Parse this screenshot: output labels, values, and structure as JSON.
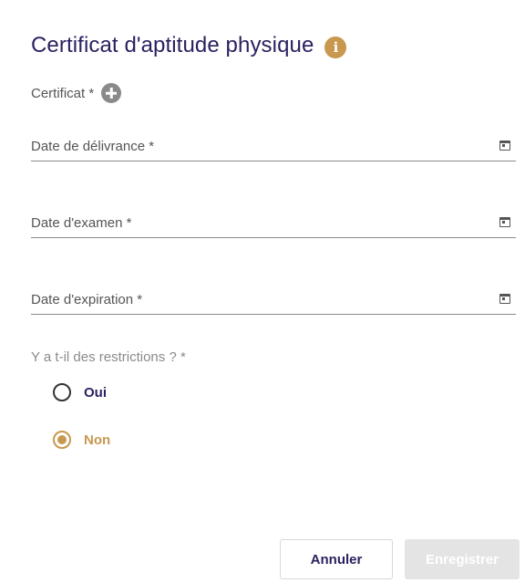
{
  "dialog": {
    "title": "Certificat d'aptitude physique",
    "info_icon": "info-icon",
    "certificate_label": "Certificat *",
    "add_icon": "plus-circle-icon"
  },
  "fields": {
    "issue_date_label": "Date de délivrance *",
    "exam_date_label": "Date d'examen *",
    "expiry_date_label": "Date d'expiration *",
    "calendar_icon": "calendar-icon"
  },
  "restrictions": {
    "question": "Y a t-il des restrictions ? *",
    "options": [
      {
        "label": "Oui",
        "selected": false
      },
      {
        "label": "Non",
        "selected": true
      }
    ]
  },
  "actions": {
    "cancel_label": "Annuler",
    "save_label": "Enregistrer"
  },
  "colors": {
    "primary": "#2a2260",
    "accent": "#c8984e",
    "disabled": "#e4e4e4"
  }
}
